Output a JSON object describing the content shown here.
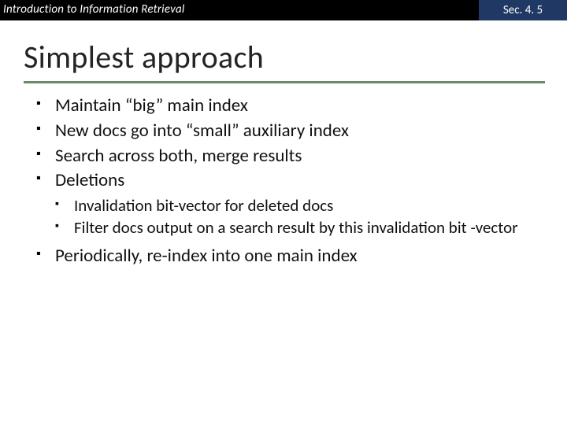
{
  "header": {
    "left": "Introduction to Information Retrieval",
    "right": "Sec. 4. 5"
  },
  "title": "Simplest approach",
  "bullets": {
    "b1": "Maintain “big” main index",
    "b2": "New docs go into “small” auxiliary index",
    "b3": "Search across both, merge results",
    "b4": "Deletions",
    "b4a": "Invalidation bit-vector for deleted docs",
    "b4b": "Filter docs output on a search result by this invalidation bit -vector",
    "b5": "Periodically, re-index into one main index"
  }
}
